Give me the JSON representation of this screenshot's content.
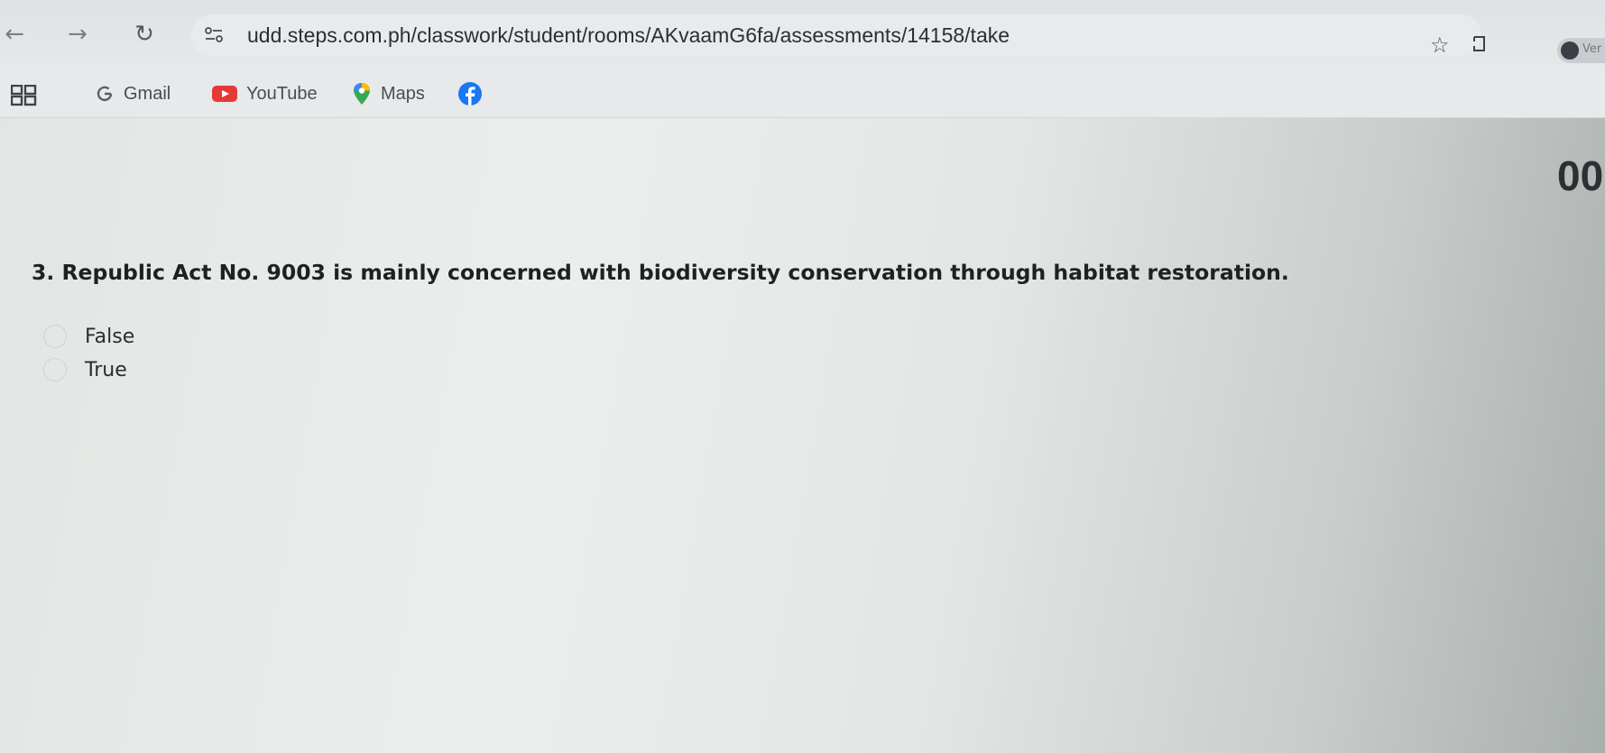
{
  "browser": {
    "url": "udd.steps.com.ph/classwork/student/rooms/AKvaamG6fa/assessments/14158/take",
    "profile_label": "Ver",
    "nav_icons": [
      "back-arrow-icon",
      "forward-arrow-icon",
      "reload-icon",
      "site-info-icon"
    ]
  },
  "bookmarks": [
    {
      "label": "Gmail",
      "icon": "google-icon"
    },
    {
      "label": "YouTube",
      "icon": "youtube-icon"
    },
    {
      "label": "Maps",
      "icon": "maps-pin-icon"
    },
    {
      "label": "",
      "icon": "facebook-icon"
    }
  ],
  "assessment": {
    "timer": "00",
    "question": "3. Republic Act No. 9003 is mainly concerned with biodiversity conservation through habitat restoration.",
    "options": [
      {
        "label": "False",
        "selected": false
      },
      {
        "label": "True",
        "selected": false
      }
    ]
  }
}
